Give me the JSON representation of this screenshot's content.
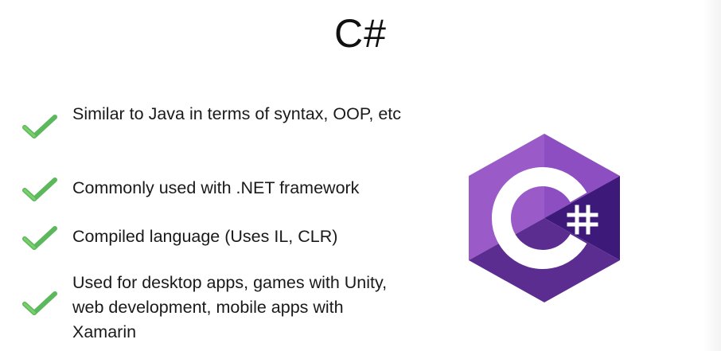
{
  "slide": {
    "title": "C#",
    "bullets": [
      {
        "text": "Similar to Java in terms of syntax, OOP, etc"
      },
      {
        "text": "Commonly used with .NET framework"
      },
      {
        "text": "Compiled language (Uses IL, CLR)"
      },
      {
        "text": "Used for desktop apps, games with Unity, web development, mobile apps with Xamarin"
      }
    ],
    "logo": {
      "icon": "csharp-logo-icon",
      "symbol": "#"
    }
  },
  "colors": {
    "check_green": "#5cb85c",
    "logo_light": "#9b4f96",
    "logo_mid": "#68217a",
    "logo_dark": "#4b1a6f"
  }
}
